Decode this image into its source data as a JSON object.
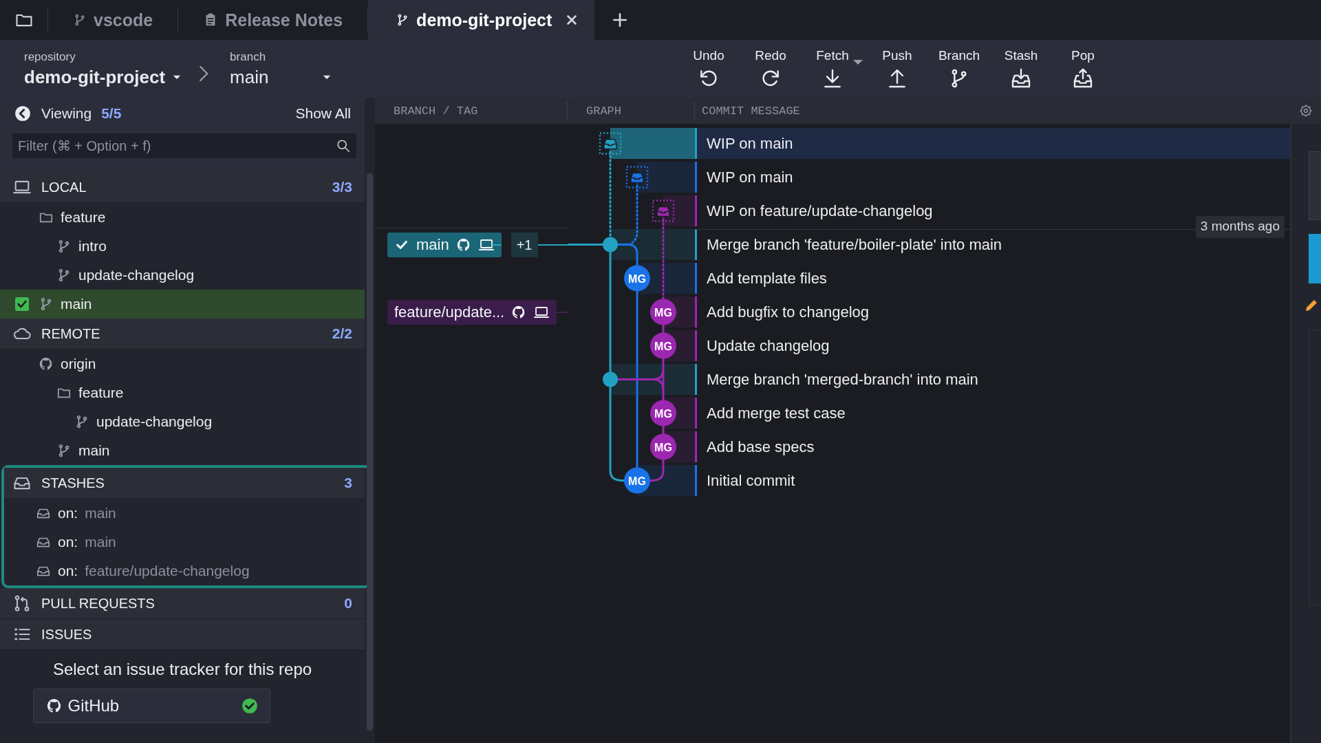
{
  "tabs": [
    {
      "label": "vscode",
      "selected": false
    },
    {
      "label": "Release Notes",
      "selected": false
    },
    {
      "label": "demo-git-project",
      "selected": true
    }
  ],
  "toolbar": {
    "repository": {
      "caption": "repository",
      "value": "demo-git-project"
    },
    "branch": {
      "caption": "branch",
      "value": "main"
    },
    "buttons": [
      {
        "label": "Undo",
        "menu": false
      },
      {
        "label": "Redo",
        "menu": false
      },
      {
        "label": "Fetch",
        "menu": true
      },
      {
        "label": "Push",
        "menu": false
      },
      {
        "label": "Branch",
        "menu": false
      },
      {
        "label": "Stash",
        "menu": false
      },
      {
        "label": "Pop",
        "menu": false
      }
    ]
  },
  "sidebar": {
    "viewing": {
      "label": "Viewing",
      "count": "5/5"
    },
    "show_all": "Show All",
    "filter": {
      "placeholder": "Filter (⌘ + Option + f)"
    },
    "sections": [
      {
        "kind": "local",
        "title": "LOCAL",
        "count": "3/3",
        "highlighted": false,
        "items": [
          {
            "kind": "folder",
            "label": "feature",
            "checked": false,
            "children": [
              {
                "kind": "branch",
                "label": "intro",
                "checked": false
              },
              {
                "kind": "branch",
                "label": "update-changelog",
                "checked": false
              }
            ]
          },
          {
            "kind": "branch",
            "label": "main",
            "checked": true
          }
        ]
      },
      {
        "kind": "remote",
        "title": "REMOTE",
        "count": "2/2",
        "highlighted": false,
        "items": [
          {
            "kind": "remote",
            "label": "origin",
            "checked": false,
            "children": [
              {
                "kind": "folder",
                "label": "feature",
                "checked": false,
                "children": [
                  {
                    "kind": "branch",
                    "label": "update-changelog",
                    "checked": false
                  }
                ]
              },
              {
                "kind": "branch",
                "label": "main",
                "checked": false
              }
            ]
          }
        ]
      },
      {
        "kind": "stashes",
        "title": "STASHES",
        "count": "3",
        "highlighted": true,
        "items": [
          {
            "kind": "stash",
            "prefix": "on:",
            "label": "main",
            "checked": false
          },
          {
            "kind": "stash",
            "prefix": "on:",
            "label": "main",
            "checked": false
          },
          {
            "kind": "stash",
            "prefix": "on:",
            "label": "feature/update-changelog",
            "checked": false
          }
        ]
      },
      {
        "kind": "pull_requests",
        "title": "PULL REQUESTS",
        "count": "0",
        "highlighted": false
      },
      {
        "kind": "issues",
        "title": "ISSUES",
        "highlighted": false,
        "message": "Select an issue tracker for this repo",
        "trackers": [
          {
            "label": "GitHub",
            "connected": true
          }
        ]
      }
    ]
  },
  "graph": {
    "columns": [
      "BRANCH / TAG",
      "GRAPH",
      "COMMIT MESSAGE"
    ],
    "commits": [
      {
        "message": "WIP on main",
        "kind": "stash",
        "color": "#22a2c3",
        "selected": true
      },
      {
        "message": "WIP on main",
        "kind": "stash",
        "color": "#1a73e8",
        "selected": false
      },
      {
        "message": "WIP on feature/update-changelog",
        "kind": "stash",
        "color": "#9c27b0",
        "selected": false
      },
      {
        "message": "Merge branch 'feature/boiler-plate' into main",
        "kind": "merge",
        "color": "#22a2c3",
        "selected": false,
        "time": "3 months ago",
        "ref": {
          "label": "main",
          "checked": true,
          "count": "+1",
          "color": "#1b6676"
        }
      },
      {
        "message": "Add template files",
        "kind": "commit",
        "color": "#1a73e8",
        "selected": false,
        "avatar": "MG"
      },
      {
        "message": "Add bugfix to changelog",
        "kind": "commit",
        "color": "#9c27b0",
        "selected": false,
        "avatar": "MG",
        "ref": {
          "label": "feature/update...",
          "checked": false,
          "color": "#3a1d4a"
        }
      },
      {
        "message": "Update changelog",
        "kind": "commit",
        "color": "#9c27b0",
        "selected": false,
        "avatar": "MG"
      },
      {
        "message": "Merge branch 'merged-branch' into main",
        "kind": "merge",
        "color": "#22a2c3",
        "selected": false
      },
      {
        "message": "Add merge test case",
        "kind": "commit",
        "color": "#9c27b0",
        "selected": false,
        "avatar": "MG"
      },
      {
        "message": "Add base specs",
        "kind": "commit",
        "color": "#9c27b0",
        "selected": false,
        "avatar": "MG"
      },
      {
        "message": "Initial commit",
        "kind": "commit",
        "color": "#1a73e8",
        "selected": false,
        "avatar": "MG"
      }
    ]
  }
}
